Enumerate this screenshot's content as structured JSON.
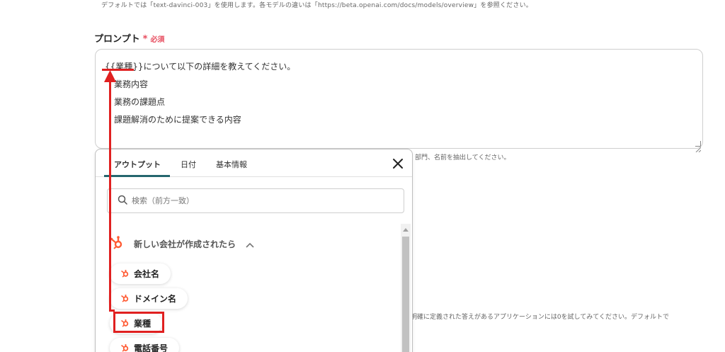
{
  "top_note": "デフォルトでは「text-davinci-003」を使用します。各モデルの違いは「https://beta.openai.com/docs/models/overview」を参照ください。",
  "prompt": {
    "label": "プロンプト",
    "required_mark": "*",
    "required_text": "必須",
    "lines": [
      {
        "token": "{{業種}}",
        "text": "について以下の詳細を教えてください。"
      },
      {
        "text": "業務内容"
      },
      {
        "text": "業務の課題点"
      },
      {
        "text": "課題解消のために提案できる内容"
      }
    ]
  },
  "hint_under": "部門、名前を抽出してください。",
  "hint_bottom": "明確に定義された答えがあるアプリケーションには0を試してみてください。デフォルトで",
  "panel": {
    "tabs": [
      "アウトプット",
      "日付",
      "基本情報"
    ],
    "active_tab": "アウトプット",
    "search_placeholder": "検索（前方一致）",
    "section_title": "新しい会社が作成されたら",
    "items": [
      "会社名",
      "ドメイン名",
      "業種",
      "電話番号"
    ]
  },
  "colors": {
    "accent": "#25666e",
    "required": "#e74c5e",
    "annotation": "#e02020",
    "hubspot": "#ff5c35"
  }
}
